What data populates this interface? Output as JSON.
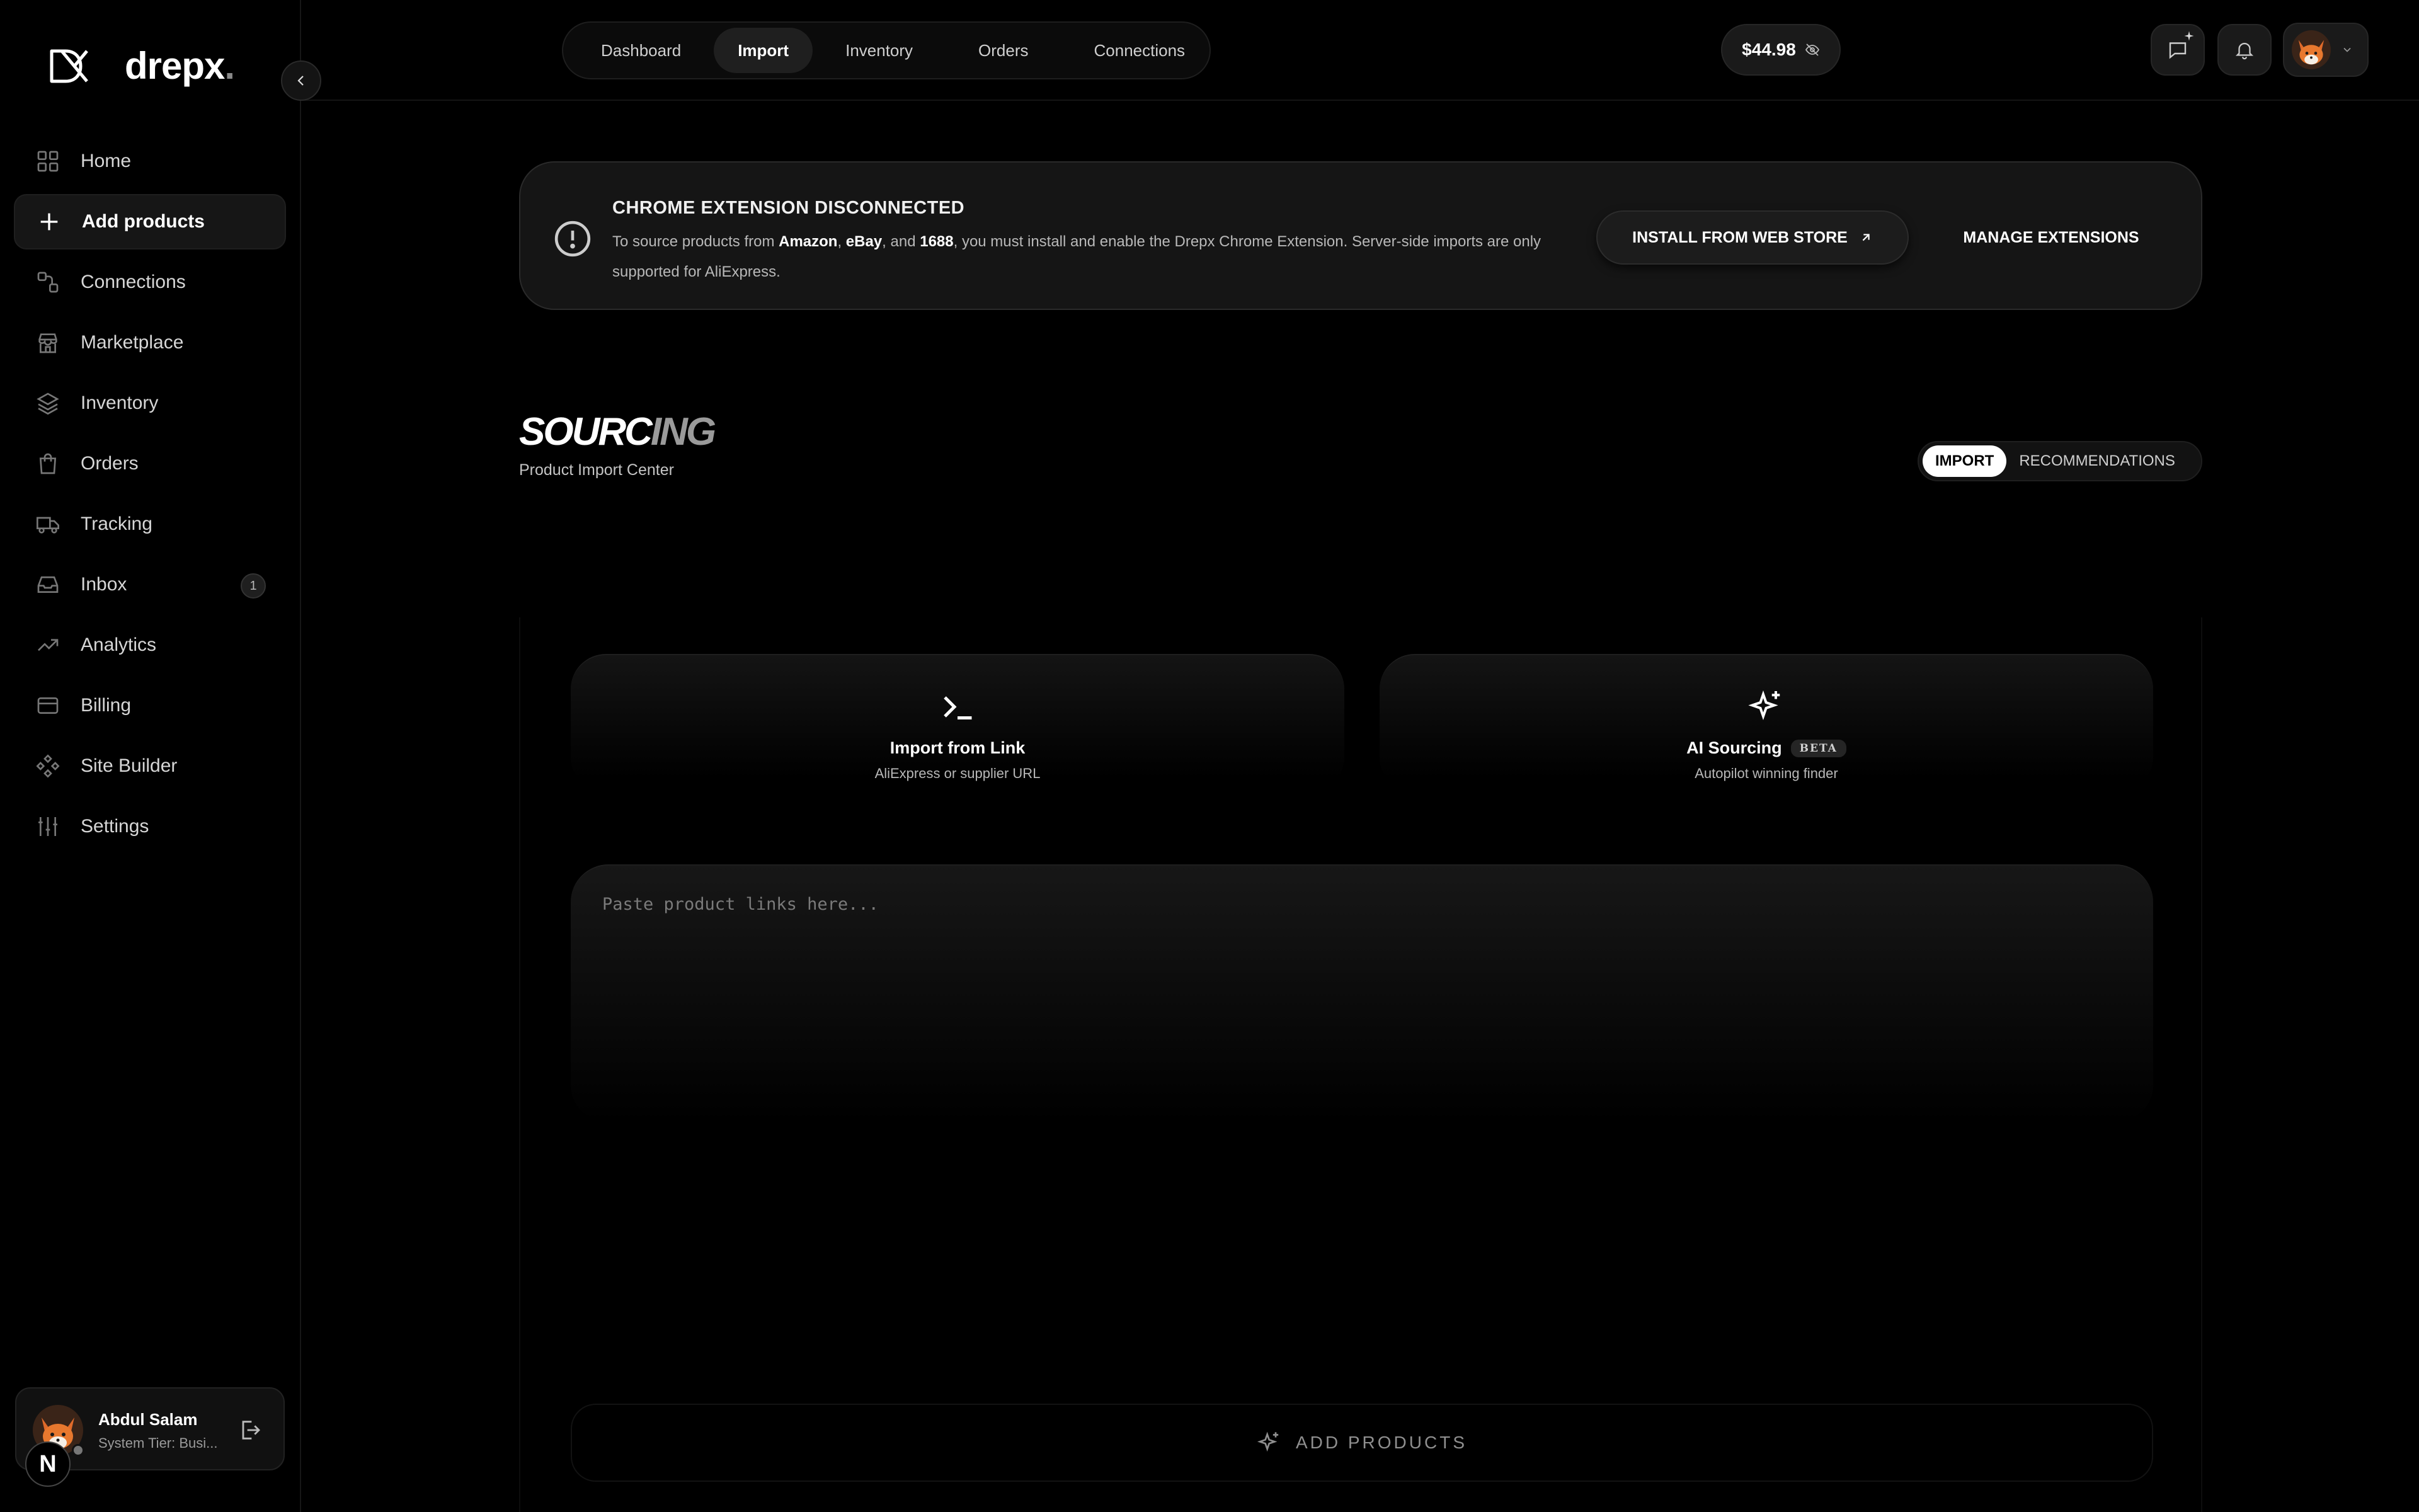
{
  "brand": {
    "name": "drepx",
    "dot": "."
  },
  "sidebar": {
    "items": [
      {
        "label": "Home",
        "icon": "grid-icon"
      },
      {
        "label": "Add products",
        "icon": "plus-icon",
        "active": true
      },
      {
        "label": "Connections",
        "icon": "connections-icon"
      },
      {
        "label": "Marketplace",
        "icon": "store-icon"
      },
      {
        "label": "Inventory",
        "icon": "layers-icon"
      },
      {
        "label": "Orders",
        "icon": "bag-icon"
      },
      {
        "label": "Tracking",
        "icon": "truck-icon"
      },
      {
        "label": "Inbox",
        "icon": "inbox-icon",
        "badge": "1"
      },
      {
        "label": "Analytics",
        "icon": "trending-icon"
      },
      {
        "label": "Billing",
        "icon": "card-icon"
      },
      {
        "label": "Site Builder",
        "icon": "components-icon"
      },
      {
        "label": "Settings",
        "icon": "sliders-icon"
      }
    ],
    "user": {
      "name": "Abdul Salam",
      "tier": "System Tier: Busi..."
    },
    "n_badge": "N"
  },
  "topbar": {
    "tabs": [
      "Dashboard",
      "Import",
      "Inventory",
      "Orders",
      "Connections"
    ],
    "active_tab": "Import",
    "balance": "$44.98"
  },
  "alert": {
    "title": "CHROME EXTENSION DISCONNECTED",
    "body_prefix": "To source products from ",
    "store_1": "Amazon",
    "sep_1": ", ",
    "store_2": "eBay",
    "sep_2": ", and ",
    "store_3": "1688",
    "body_suffix": ", you must install and enable the Drepx Chrome Extension. Server-side imports are only supported for AliExpress.",
    "install_label": "INSTALL FROM WEB STORE",
    "manage_label": "MANAGE EXTENSIONS"
  },
  "sourcing": {
    "title_a": "SOURC",
    "title_b": "ING",
    "subtitle": "Product Import Center",
    "modes": [
      "IMPORT",
      "RECOMMENDATIONS"
    ],
    "active_mode": "IMPORT"
  },
  "methods": [
    {
      "title": "Import from Link",
      "subtitle": "AliExpress or supplier URL",
      "icon": "terminal-icon"
    },
    {
      "title": "AI Sourcing",
      "badge": "BETA",
      "subtitle": "Autopilot winning finder",
      "icon": "sparkles-icon"
    }
  ],
  "paste": {
    "placeholder": "Paste product links here...",
    "value": ""
  },
  "add_products_label": "ADD PRODUCTS",
  "colors": {
    "background": "#000000",
    "card": "#151515",
    "accent": "#ffffff",
    "muted": "#9a9a9a"
  }
}
